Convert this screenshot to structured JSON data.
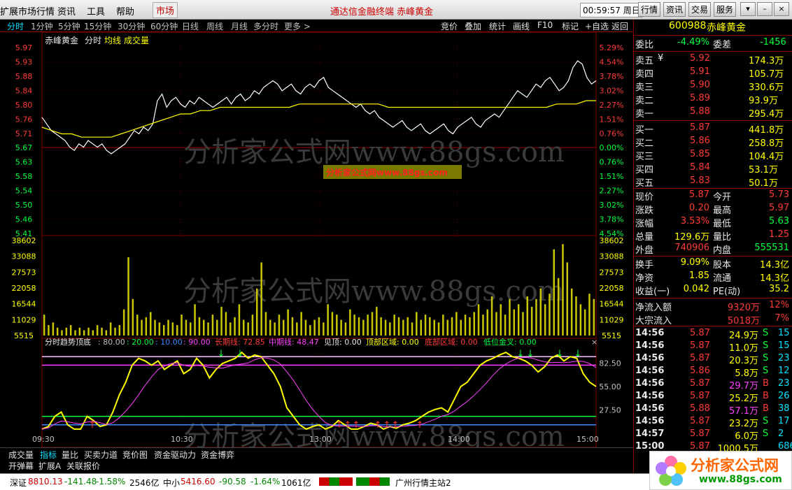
{
  "menubar": {
    "app_title": "扩展市场行情",
    "menus": [
      "资讯",
      "工具",
      "帮助"
    ],
    "market_button": "市场",
    "title": "通达信金融终端  赤峰黄金",
    "clock": "00:59:57 周日",
    "right_buttons": [
      "行情",
      "资讯",
      "交易",
      "服务"
    ],
    "window_buttons": [
      "▾",
      "–",
      "□",
      "×"
    ]
  },
  "period_bar": {
    "periods": [
      "分时",
      "1分钟",
      "5分钟",
      "15分钟",
      "30分钟",
      "60分钟",
      "日线",
      "周线",
      "月线",
      "多分时",
      "更多 >"
    ],
    "tools": [
      "竞价",
      "叠加",
      "统计",
      "画线",
      "F10",
      "标记",
      "+自选",
      "返回"
    ]
  },
  "chart_info": {
    "stock_name": "赤峰黄金",
    "view": "分时",
    "avg_label": "均线",
    "vol_label": "成交量"
  },
  "price_axis": {
    "left": [
      "5.97",
      "5.93",
      "5.88",
      "5.84",
      "5.80",
      "5.76",
      "5.71",
      "5.67",
      "5.63",
      "5.58",
      "5.54",
      "5.50",
      "5.46",
      "5.41"
    ],
    "right": [
      "5.29%",
      "4.54%",
      "3.78%",
      "3.02%",
      "2.27%",
      "1.51%",
      "0.76%",
      "0.00%",
      "0.76%",
      "1.51%",
      "2.27%",
      "3.02%",
      "3.78%",
      "4.54%"
    ]
  },
  "volume_axis": [
    "38602",
    "33088",
    "27573",
    "22058",
    "16544",
    "11029",
    "5515"
  ],
  "indicator": {
    "title": "分时趋势顶底",
    "params": [
      ": 80.00",
      ": 20.00",
      ": 10.00",
      ": 90.00"
    ],
    "long_line": "长期线: 72.85",
    "mid_line": "中期线: 48.47",
    "seen_top": "见顶: 0.00",
    "top_zone": "顶部区域: 0.00",
    "bottom_zone": "底部区域: 0.00",
    "low_cross": "低位金叉: 0.00",
    "axis": [
      "82.50",
      "55.00",
      "27.50"
    ],
    "close": "×"
  },
  "time_axis": [
    "09:30",
    "10:30",
    "13:00",
    "14:00",
    "15:00"
  ],
  "watermark": {
    "text": "分析家公式网www.88gs.com",
    "banner": "分析家公式网www.88gs.com"
  },
  "chart_data": {
    "type": "line",
    "title": "赤峰黄金 分时",
    "prev_close": 5.71,
    "ylim": [
      5.41,
      5.97
    ],
    "series": [
      {
        "name": "价格",
        "values": [
          5.76,
          5.74,
          5.72,
          5.71,
          5.7,
          5.69,
          5.67,
          5.66,
          5.68,
          5.67,
          5.69,
          5.68,
          5.67,
          5.68,
          5.66,
          5.65,
          5.66,
          5.67,
          5.68,
          5.7,
          5.72,
          5.71,
          5.73,
          5.72,
          5.74,
          5.81,
          5.83,
          5.79,
          5.81,
          5.82,
          5.8,
          5.79,
          5.81,
          5.8,
          5.82,
          5.81,
          5.8,
          5.79,
          5.8,
          5.81,
          5.82,
          5.8,
          5.82,
          5.83,
          5.81,
          5.82,
          5.84,
          5.83,
          5.85,
          5.86,
          5.87,
          5.86,
          5.84,
          5.85,
          5.86,
          5.84,
          5.83,
          5.85,
          5.86,
          5.85,
          5.87,
          5.88,
          5.85,
          5.84,
          5.83,
          5.82,
          5.81,
          5.8,
          5.79,
          5.8,
          5.78,
          5.77,
          5.78,
          5.76,
          5.75,
          5.74,
          5.73,
          5.74,
          5.75,
          5.73,
          5.72,
          5.73,
          5.74,
          5.72,
          5.71,
          5.72,
          5.73,
          5.74,
          5.72,
          5.71,
          5.73,
          5.74,
          5.75,
          5.76,
          5.74,
          5.73,
          5.75,
          5.76,
          5.77,
          5.76,
          5.78,
          5.8,
          5.82,
          5.84,
          5.83,
          5.82,
          5.84,
          5.86,
          5.85,
          5.87,
          5.88,
          5.86,
          5.84,
          5.85,
          5.87,
          5.91,
          5.93,
          5.92,
          5.88,
          5.86,
          5.87
        ]
      },
      {
        "name": "均线",
        "values": [
          5.73,
          5.72,
          5.71,
          5.71,
          5.7,
          5.7,
          5.7,
          5.7,
          5.71,
          5.72,
          5.73,
          5.74,
          5.75,
          5.76,
          5.77,
          5.77,
          5.78,
          5.78,
          5.79,
          5.79,
          5.79,
          5.79,
          5.79,
          5.79,
          5.79,
          5.79,
          5.8,
          5.8,
          5.8,
          5.8,
          5.8,
          5.8,
          5.8,
          5.8,
          5.8,
          5.79,
          5.79,
          5.79,
          5.79,
          5.79,
          5.79,
          5.79,
          5.79,
          5.79,
          5.79,
          5.79,
          5.79,
          5.79,
          5.79,
          5.79,
          5.79,
          5.79,
          5.8,
          5.8,
          5.8,
          5.81,
          5.81
        ]
      }
    ],
    "volume": [
      8,
      4,
      5,
      3,
      2,
      3,
      4,
      2,
      3,
      2,
      3,
      2,
      4,
      3,
      2,
      5,
      3,
      4,
      10,
      30,
      14,
      8,
      6,
      7,
      9,
      6,
      5,
      4,
      6,
      5,
      4,
      8,
      6,
      5,
      12,
      7,
      6,
      5,
      8,
      6,
      11,
      9,
      5,
      7,
      12,
      6,
      5,
      8,
      18,
      28,
      9,
      6,
      5,
      8,
      6,
      10,
      7,
      5,
      9,
      6,
      4,
      6,
      7,
      5,
      12,
      9,
      8,
      6,
      5,
      10,
      8,
      7,
      6,
      8,
      9,
      11,
      7,
      6,
      5,
      8,
      7,
      6,
      7,
      5,
      9,
      6,
      8,
      7,
      6,
      5,
      8,
      6,
      7,
      9,
      6,
      8,
      7,
      9,
      12,
      8,
      10,
      15,
      9,
      12,
      8,
      14,
      10,
      12,
      9,
      15,
      11,
      14,
      18,
      12,
      16,
      33,
      22,
      35,
      28,
      18,
      15,
      12,
      10,
      16,
      14
    ]
  },
  "order_book": {
    "code": "600988",
    "name": "赤峰黄金",
    "weibi_label": "委比",
    "weibi": "-4.49%",
    "weicha_label": "委差",
    "weicha": "-1456",
    "asks": [
      {
        "label": "卖五",
        "mark": "¥",
        "price": "5.92",
        "vol": "174.3万"
      },
      {
        "label": "卖四",
        "price": "5.91",
        "vol": "105.7万"
      },
      {
        "label": "卖三",
        "price": "5.90",
        "vol": "330.6万"
      },
      {
        "label": "卖二",
        "price": "5.89",
        "vol": "93.9万"
      },
      {
        "label": "卖一",
        "price": "5.88",
        "vol": "295.4万"
      }
    ],
    "bids": [
      {
        "label": "买一",
        "price": "5.87",
        "vol": "441.8万"
      },
      {
        "label": "买二",
        "price": "5.86",
        "vol": "258.8万"
      },
      {
        "label": "买三",
        "price": "5.85",
        "vol": "104.4万"
      },
      {
        "label": "买四",
        "price": "5.84",
        "vol": "53.1万"
      },
      {
        "label": "买五",
        "price": "5.83",
        "vol": "50.1万"
      }
    ]
  },
  "quote": {
    "rows": [
      [
        "现价",
        "5.87",
        "今开",
        "5.73"
      ],
      [
        "涨跌",
        "0.20",
        "最高",
        "5.97"
      ],
      [
        "涨幅",
        "3.53%",
        "最低",
        "5.63"
      ],
      [
        "总量",
        "129.6万",
        "量比",
        "1.25"
      ],
      [
        "外盘",
        "740906",
        "内盘",
        "555531"
      ]
    ],
    "rows2": [
      [
        "换手",
        "9.09%",
        "股本",
        "14.3亿"
      ],
      [
        "净资",
        "1.85",
        "流通",
        "14.3亿"
      ],
      [
        "收益(一)",
        "0.042",
        "PE(动)",
        "35.2"
      ]
    ],
    "flow": [
      [
        "净流入额",
        "9320万",
        "12%"
      ],
      [
        "大宗流入",
        "5018万",
        "7%"
      ]
    ]
  },
  "ticks": [
    [
      "14:56",
      "5.87",
      "24.9万",
      "S",
      "15"
    ],
    [
      "14:56",
      "5.87",
      "11.0万",
      "S",
      "15"
    ],
    [
      "14:56",
      "5.87",
      "20.3万",
      "S",
      "23"
    ],
    [
      "14:56",
      "5.86",
      "5.8万",
      "S",
      "12"
    ],
    [
      "14:56",
      "5.87",
      "29.7万",
      "B",
      "23"
    ],
    [
      "14:56",
      "5.87",
      "25.2万",
      "B",
      "26"
    ],
    [
      "14:56",
      "5.88",
      "57.1万",
      "B",
      "38"
    ],
    [
      "14:56",
      "5.87",
      "23.2万",
      "S",
      "17"
    ],
    [
      "14:57",
      "5.87",
      "6.0万",
      "S",
      "2"
    ],
    [
      "15:00",
      "5.87",
      "1000.5万",
      "",
      "686"
    ]
  ],
  "bottom_tabs": [
    "成交量",
    "指标",
    "量比",
    "买卖力道",
    "竞价图",
    "资金驱动力",
    "资金博弈"
  ],
  "bottom_tabs2": [
    "开弹幕",
    "扩展A",
    "关联报价"
  ],
  "status": {
    "sz_label": "深证",
    "sz_val": "8810.13",
    "sz_chg": "-141.48",
    "sz_pct": "-1.58%",
    "sz_amt": "2546亿",
    "zx_label": "中小",
    "zx_val": "5416.60",
    "zx_chg": "-90.58",
    "zx_pct": "-1.64%",
    "zx_amt": "1061亿",
    "site": "广州行情主站2"
  },
  "logo": {
    "name": "分析家公式网",
    "url": "www.88gs.com"
  },
  "colors": {
    "up": "#ff3a3a",
    "down": "#00ff40",
    "price_line": "#ffffff",
    "avg_line": "#ffff00",
    "grid": "#800000"
  }
}
